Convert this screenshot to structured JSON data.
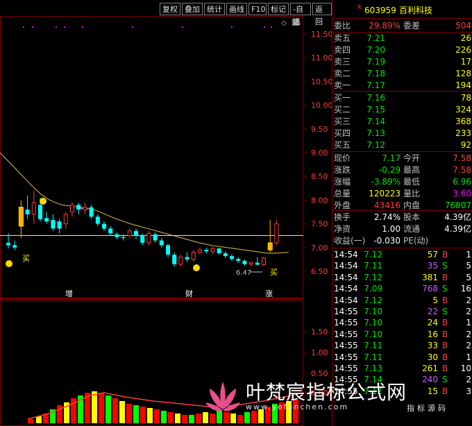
{
  "toolbar": [
    {
      "label": "复权"
    },
    {
      "label": "叠加"
    },
    {
      "label": "统计"
    },
    {
      "label": "画线"
    },
    {
      "label": "F10"
    },
    {
      "label": "标记"
    },
    {
      "label": "-自选"
    },
    {
      "label": "返回"
    }
  ],
  "stock": {
    "badge": "R",
    "code": "603959",
    "name": "百利科技"
  },
  "weibi": {
    "label1": "委比",
    "value1": "29.89%",
    "label2": "委差",
    "value2": "504"
  },
  "asks": [
    {
      "label": "卖五",
      "price": "7.21",
      "vol": "26"
    },
    {
      "label": "卖四",
      "price": "7.20",
      "vol": "226"
    },
    {
      "label": "卖三",
      "price": "7.19",
      "vol": "17"
    },
    {
      "label": "卖二",
      "price": "7.18",
      "vol": "128"
    },
    {
      "label": "卖一",
      "price": "7.17",
      "vol": "194"
    }
  ],
  "bids": [
    {
      "label": "买一",
      "price": "7.16",
      "vol": "78"
    },
    {
      "label": "买二",
      "price": "7.15",
      "vol": "324"
    },
    {
      "label": "买三",
      "price": "7.14",
      "vol": "368"
    },
    {
      "label": "买四",
      "price": "7.13",
      "vol": "233"
    },
    {
      "label": "买五",
      "price": "7.12",
      "vol": "92"
    }
  ],
  "quote": [
    {
      "l1": "现价",
      "v1": "7.17",
      "c1": "grn",
      "l2": "今开",
      "v2": "7.58",
      "c2": "red"
    },
    {
      "l1": "涨跌",
      "v1": "-0.29",
      "c1": "grn",
      "l2": "最高",
      "v2": "7.58",
      "c2": "red"
    },
    {
      "l1": "涨幅",
      "v1": "-3.89%",
      "c1": "grn",
      "l2": "最低",
      "v2": "6.96",
      "c2": "grn"
    },
    {
      "l1": "总量",
      "v1": "120223",
      "c1": "yel",
      "l2": "量比",
      "v2": "3.60",
      "c2": "mag"
    },
    {
      "l1": "外盘",
      "v1": "43416",
      "c1": "red",
      "l2": "内盘",
      "v2": "76807",
      "c2": "grn"
    }
  ],
  "fund": [
    {
      "l1": "换手",
      "v1": "2.74%",
      "l2": "股本",
      "v2": "4.39亿"
    },
    {
      "l1": "净资",
      "v1": "1.00",
      "l2": "流通",
      "v2": "4.39亿"
    },
    {
      "l1": "收益(一)",
      "v1": "-0.030",
      "l2": "PE(动)",
      "v2": ""
    }
  ],
  "ticks": [
    {
      "t": "14:54",
      "p": "7.12",
      "v": "57",
      "d": "B",
      "n": "1"
    },
    {
      "t": "14:54",
      "p": "7.11",
      "v": "35",
      "d": "S",
      "n": "5"
    },
    {
      "t": "14:54",
      "p": "7.12",
      "v": "381",
      "d": "B",
      "n": "5"
    },
    {
      "t": "14:54",
      "p": "7.09",
      "v": "768",
      "d": "S",
      "n": "16"
    },
    {
      "t": "14:54",
      "p": "7.12",
      "v": "5",
      "d": "B",
      "n": "2"
    },
    {
      "t": "14:55",
      "p": "7.10",
      "v": "22",
      "d": "S",
      "n": "2"
    },
    {
      "t": "14:55",
      "p": "7.10",
      "v": "24",
      "d": "B",
      "n": "1"
    },
    {
      "t": "14:55",
      "p": "7.10",
      "v": "16",
      "d": "B",
      "n": "2"
    },
    {
      "t": "14:55",
      "p": "7.11",
      "v": "33",
      "d": "B",
      "n": "2"
    },
    {
      "t": "14:55",
      "p": "7.11",
      "v": "30",
      "d": "B",
      "n": "1"
    },
    {
      "t": "14:55",
      "p": "7.13",
      "v": "261",
      "d": "B",
      "n": "10"
    },
    {
      "t": "14:55",
      "p": "7.14",
      "v": "240",
      "d": "S",
      "n": "2"
    },
    {
      "t": "14:55",
      "p": "7.12",
      "v": "15",
      "d": "B",
      "n": "3"
    }
  ],
  "price_axis": [
    "11.50",
    "11.00",
    "10.50",
    "10.00",
    "9.50",
    "9.00",
    "8.50",
    "8.00",
    "7.50",
    "7.00",
    "6.50"
  ],
  "lower_axis": [
    "1.50",
    "1.00",
    "0.50",
    "0.00"
  ],
  "markers": {
    "buy1": "买",
    "buy2": "买",
    "low_label": "6.47",
    "zeng": "增",
    "cai": "财",
    "zhang": "涨"
  },
  "watermark": {
    "title": "叶梵宸指标公式网",
    "url": "www.yefanchen.com",
    "sub": "指标源码"
  },
  "colors": {
    "up": "#ff3c3c",
    "down": "#00ffff",
    "ma": "#d8c050",
    "grid": "#800000"
  }
}
